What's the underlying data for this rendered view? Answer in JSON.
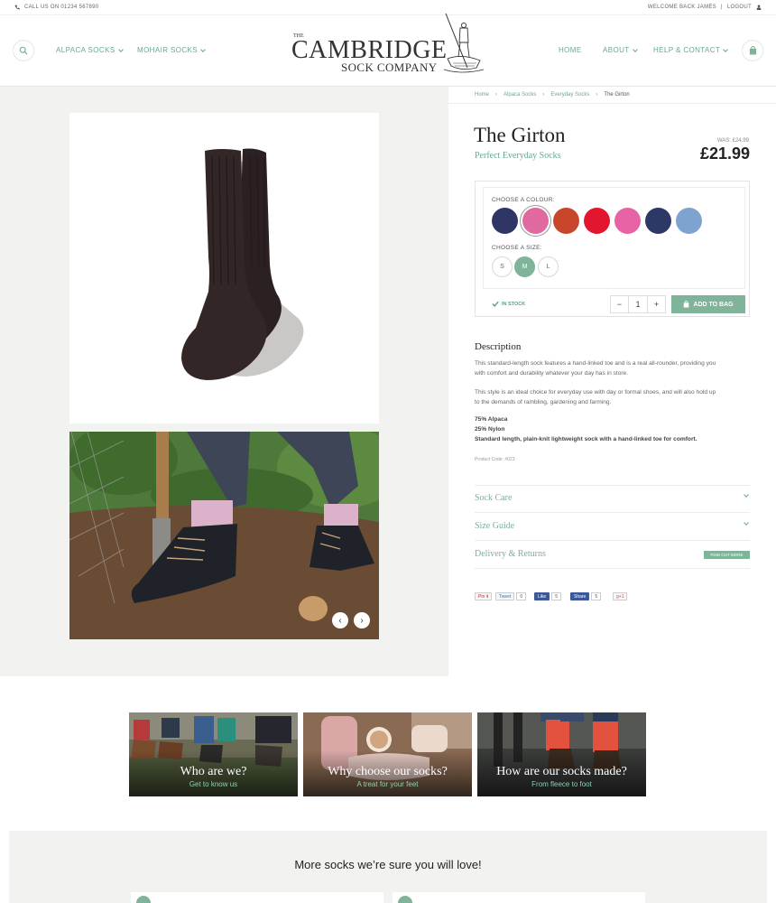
{
  "topbar": {
    "phone": "CALL US ON 01234 567890",
    "welcome": "WELCOME BACK JAMES",
    "separator": "|",
    "logout": "LOGOUT"
  },
  "header": {
    "nav_left": [
      "ALPACA SOCKS",
      "MOHAIR SOCKS"
    ],
    "nav_right": [
      "HOME",
      "ABOUT",
      "HELP & CONTACT"
    ],
    "logo": {
      "the": "THE",
      "main": "CAMBRIDGE",
      "sub": "SOCK COMPANY"
    }
  },
  "breadcrumb": [
    "Home",
    "Alpaca Socks",
    "Everyday Socks",
    "The Girton"
  ],
  "product": {
    "title": "The Girton",
    "subtitle": "Perfect Everyday Socks",
    "was_price": "WAS: £24.99",
    "price": "£21.99",
    "colour_label": "CHOOSE A COLOUR:",
    "colours": [
      "#2f3666",
      "#e06aa0",
      "#c8472c",
      "#e2162f",
      "#e664a6",
      "#2e3866",
      "#7ea3cf"
    ],
    "selected_colour_index": 1,
    "size_label": "CHOOSE A SIZE:",
    "sizes": [
      "S",
      "M",
      "L"
    ],
    "selected_size": "M",
    "stock": "IN STOCK",
    "qty_minus": "−",
    "qty": "1",
    "qty_plus": "+",
    "add_to_bag": "ADD TO BAG"
  },
  "description": {
    "heading": "Description",
    "para1_line1": "This standard-length sock features a hand-linked toe and is a real all-rounder, providing you",
    "para1_line2": "with comfort and durability whatever your day has in store.",
    "para2_line1": "This style is an ideal choice for everyday use with day or formal shoes, and will also hold up",
    "para2_line2": "to the demands of rambling, gardening and farming.",
    "spec1": "75% Alpaca",
    "spec2": "25% Nylon",
    "spec3": "Standard length, plain-knit lightweight sock with a hand-linked toe for comfort.",
    "product_code": "Product Code: #023"
  },
  "accordion": {
    "items": [
      "Sock Care",
      "Size Guide",
      "Delivery & Returns"
    ],
    "find_out_more": "FIND OUT MORE"
  },
  "social": {
    "pin": "Pin it",
    "tweet": "Tweet",
    "tweet_count": "0",
    "like": "Like",
    "like_count": "5",
    "share": "Share",
    "share_count": "5",
    "gplus": "g+1"
  },
  "slider": {
    "prev": "‹",
    "next": "›"
  },
  "promos": [
    {
      "title": "Who are we?",
      "subtitle": "Get to know us"
    },
    {
      "title": "Why choose our socks?",
      "subtitle": "A treat for your feet"
    },
    {
      "title": "How are our socks made?",
      "subtitle": "From fleece to foot"
    }
  ],
  "more": {
    "heading": "More socks we’re sure you will love!"
  }
}
